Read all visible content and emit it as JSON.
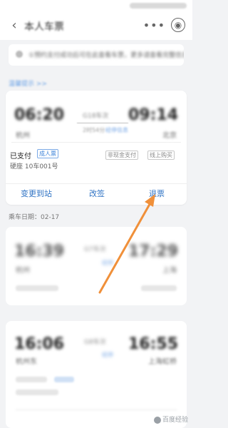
{
  "status_bar": {
    "time": ""
  },
  "header": {
    "back_icon": "chevron-left-icon",
    "title": "本人车票",
    "more_icon": "more-dots-icon",
    "close_icon": "close-circle-icon"
  },
  "notice": {
    "text": "①预约支付成功后可在此查看车票，更多请查看完整信息",
    "icon": "info-icon"
  },
  "link_text": "温馨提示 >>",
  "ticket1": {
    "depart_time": "06:20",
    "arrive_time": "09:14",
    "depart_station": "杭州",
    "arrive_station": "北京",
    "train_no": "G18车次",
    "duration": "2时54分",
    "duration_link": "经停信息",
    "status": "已支付",
    "passenger_type": "成人票",
    "seat": "硬座  10车001号",
    "tag1": "非现金支付",
    "tag2": "线上购买",
    "actions": [
      "变更到站",
      "改签",
      "退票"
    ]
  },
  "ride_date": "乘车日期：02-17",
  "ticket2": {
    "depart_time": "16:39",
    "arrive_time": "17:29",
    "train_no": "G7车次",
    "duration_link": "经停",
    "depart_station": "杭州",
    "arrive_station": "上海"
  },
  "ticket3": {
    "depart_time": "16:06",
    "arrive_time": "16:55",
    "train_no": "G8车次",
    "depart_station": "杭州东",
    "arrive_station": "上海虹桥",
    "duration_link": "经停"
  },
  "watermark": "百度经验",
  "colors": {
    "accent": "#2f73c4",
    "annotation_arrow": "#f0903a"
  }
}
